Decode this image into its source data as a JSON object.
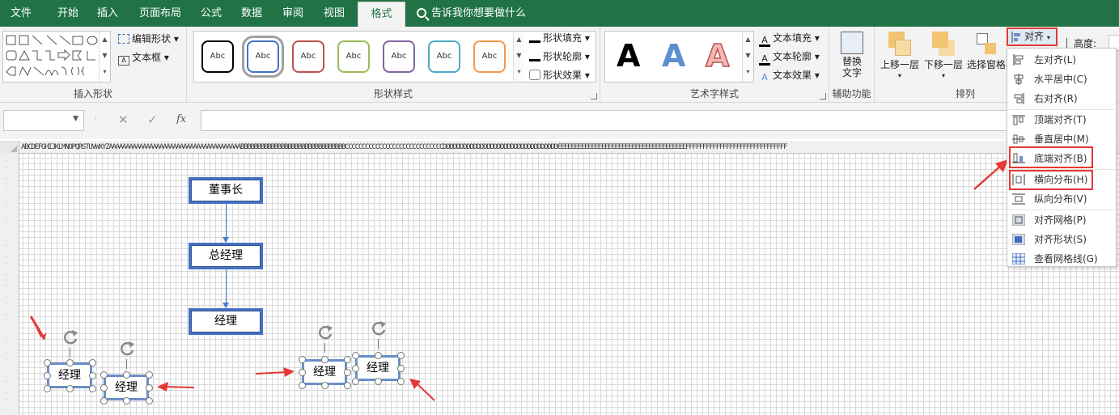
{
  "tabs": [
    "文件",
    "开始",
    "插入",
    "页面布局",
    "公式",
    "数据",
    "审阅",
    "视图",
    "格式"
  ],
  "active_tab": "格式",
  "tell_me": "告诉我你想要做什么",
  "ribbon": {
    "insert_shapes": {
      "label": "插入形状",
      "edit_shape": "编辑形状",
      "text_box": "文本框"
    },
    "shape_styles": {
      "label": "形状样式",
      "preset_text": "Abc",
      "preset_colors": [
        "#000000",
        "#4472c4",
        "#c0504d",
        "#9bbb59",
        "#8064a2",
        "#4bacc6",
        "#f79646"
      ],
      "shape_fill": "形状填充",
      "shape_outline": "形状轮廓",
      "shape_effects": "形状效果"
    },
    "wordart": {
      "label": "艺术字样式",
      "letter": "A",
      "text_fill": "文本填充",
      "text_outline": "文本轮廓",
      "text_effects": "文本效果"
    },
    "accessibility": {
      "label": "辅助功能",
      "alt_text_line1": "替换",
      "alt_text_line2": "文字"
    },
    "arrange": {
      "label": "排列",
      "bring_forward": "上移一层",
      "send_backward": "下移一层",
      "selection_pane": "选择窗格",
      "align": "对齐"
    },
    "size": {
      "height": "高度:"
    }
  },
  "align_menu": [
    {
      "label": "左对齐(L)",
      "icon": "align-left-icon"
    },
    {
      "label": "水平居中(C)",
      "icon": "align-center-icon"
    },
    {
      "label": "右对齐(R)",
      "icon": "align-right-icon"
    },
    {
      "label": "顶端对齐(T)",
      "icon": "align-top-icon"
    },
    {
      "label": "垂直居中(M)",
      "icon": "align-middle-icon"
    },
    {
      "label": "底端对齐(B)",
      "icon": "align-bottom-icon",
      "highlighted": true
    },
    {
      "label": "横向分布(H)",
      "icon": "distribute-horizontal-icon",
      "highlighted": true
    },
    {
      "label": "纵向分布(V)",
      "icon": "distribute-vertical-icon"
    },
    {
      "label": "对齐网格(P)",
      "icon": "snap-to-grid-icon"
    },
    {
      "label": "对齐形状(S)",
      "icon": "snap-to-shape-icon"
    },
    {
      "label": "查看网格线(G)",
      "icon": "view-gridlines-icon"
    }
  ],
  "formula_bar": {
    "cancel": "✕",
    "enter": "✓",
    "fx": "fx",
    "value": ""
  },
  "column_header": "ABCDEFGHIJKLMNOPQRSTUVWXYZAAAAAAAAAAAAAAAAAAAAAAAAAAAAAAAAAAAAAAABBBBBBBBBBBBBBBBBBBBBBBBBBBBBBBCCCCCCCCCCCCCCCCCCCCCCCCCCCCCDDDDDDDDDDDDDDDDDDDDDDDDDDDDDDDDDDEEEEEEEEEEEEEEEEEEEEEEEEEEEEEEEEEEEEEEFFFFFFFFFFFFFFFFFFFFFFFFFFFFFF",
  "org_chart": {
    "top": "董事长",
    "middle": "总经理",
    "bottom": "经理"
  },
  "selected_shapes": [
    "经理",
    "经理",
    "经理",
    "经理"
  ],
  "colors": {
    "excel_green": "#217346",
    "shape_border": "#4472c4",
    "highlight_red": "#e53935"
  }
}
